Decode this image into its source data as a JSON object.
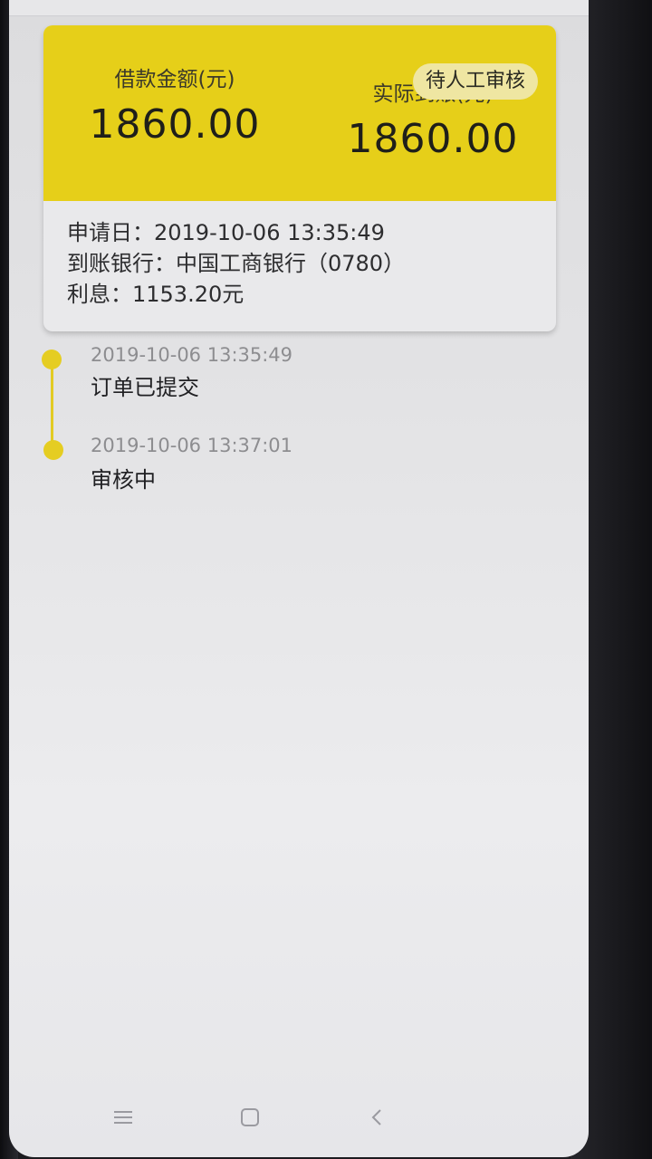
{
  "card": {
    "loan_amount_label": "借款金额(元)",
    "loan_amount_value": "1860.00",
    "actual_amount_label": "实际到账(元)",
    "actual_amount_value": "1860.00",
    "status_badge": "待人工审核",
    "apply_date": "申请日：2019-10-06 13:35:49",
    "bank": "到账银行：中国工商银行（0780）",
    "interest": "利息：1153.20元"
  },
  "timeline": [
    {
      "time": "2019-10-06 13:35:49",
      "text": "订单已提交"
    },
    {
      "time": "2019-10-06 13:37:01",
      "text": "审核中"
    }
  ],
  "navbar": {
    "items": [
      "menu-icon",
      "home-icon",
      "back-icon"
    ]
  },
  "colors": {
    "accent": "#e6cf19",
    "timeline_dot": "#e5cd22",
    "background": "#e3e3e5"
  }
}
